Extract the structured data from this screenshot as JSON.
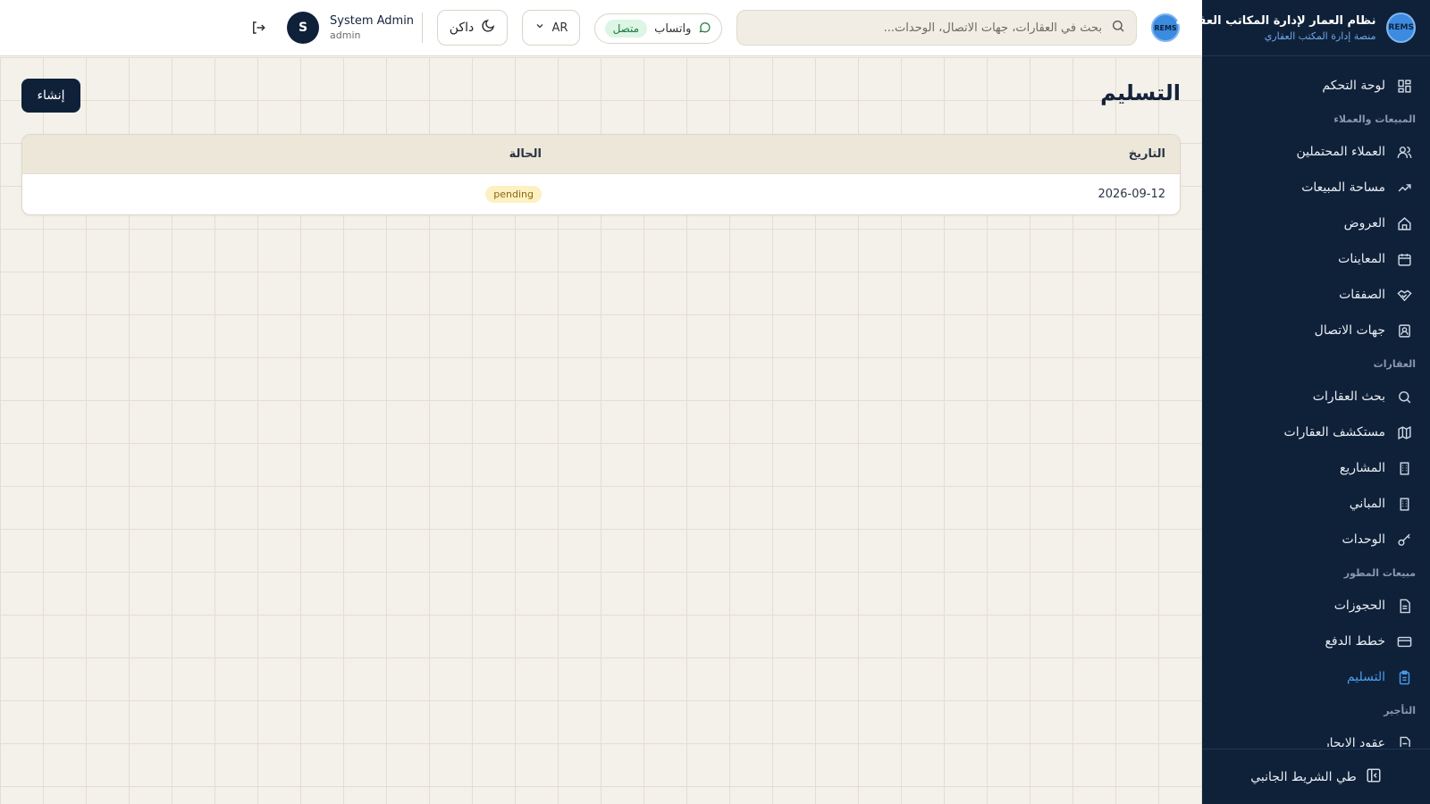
{
  "sidebar": {
    "title": "نظام العمار لإدارة المكاتب العقارية",
    "subtitle": "منصة إدارة المكتب العقاري",
    "logo_text": "REMS",
    "dashboard": "لوحة التحكم",
    "sections": {
      "sales": "المبيعات والعملاء",
      "properties": "العقارات",
      "developer": "مبيعات المطور",
      "leasing": "التأجير"
    },
    "items": {
      "leads": "العملاء المحتملين",
      "sales_space": "مساحة المبيعات",
      "offers": "العروض",
      "viewings": "المعاينات",
      "deals": "الصفقات",
      "contacts": "جهات الاتصال",
      "property_search": "بحث العقارات",
      "property_explorer": "مستكشف العقارات",
      "projects": "المشاريع",
      "buildings": "المباني",
      "units": "الوحدات",
      "bookings": "الحجوزات",
      "payment_plans": "خطط الدفع",
      "handover": "التسليم",
      "lease_contracts": "عقود الإيجار"
    },
    "collapse_label": "طي الشريط الجانبي"
  },
  "topbar": {
    "search_placeholder": "بحث في العقارات، جهات الاتصال، الوحدات...",
    "whatsapp_label": "واتساب",
    "whatsapp_status": "متصل",
    "language": "AR",
    "theme_label": "داكن",
    "user_name": "System Admin",
    "user_role": "admin",
    "avatar_initial": "S",
    "logo_text": "REMS"
  },
  "page": {
    "title": "التسليم",
    "create_label": "إنشاء",
    "table": {
      "headers": {
        "date": "التاريخ",
        "status": "الحالة"
      },
      "rows": [
        {
          "date": "2026-09-12",
          "status": "pending"
        }
      ]
    }
  },
  "colors": {
    "sidebar_bg": "#0f2139",
    "accent": "#4a9df0",
    "status_pending_bg": "#fdf0c2",
    "status_online_bg": "#dcf5e4"
  }
}
